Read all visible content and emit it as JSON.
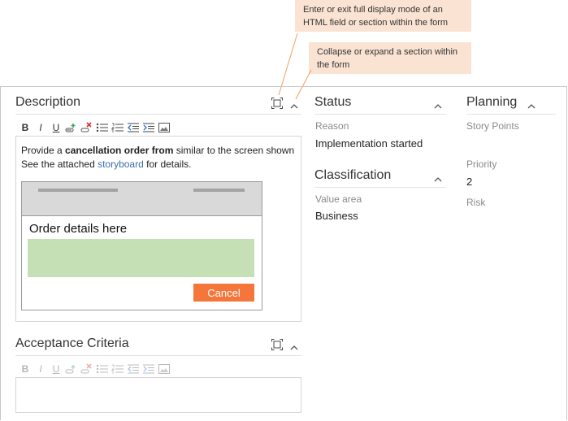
{
  "callouts": {
    "fullscreen": "Enter or exit full display mode of an HTML field or section within the form",
    "collapse": "Collapse or expand a section within the form"
  },
  "description": {
    "title": "Description",
    "text_prefix": "Provide a ",
    "text_bold": "cancellation order from",
    "text_suffix": " similar to the screen shown",
    "line2_prefix": "See the attached ",
    "line2_link": "storyboard",
    "line2_suffix": " for details.",
    "mockup": {
      "title": "Order details here",
      "cancel_label": "Cancel"
    }
  },
  "acceptance": {
    "title": "Acceptance Criteria"
  },
  "status": {
    "title": "Status",
    "reason_label": "Reason",
    "reason_value": "Implementation started"
  },
  "classification": {
    "title": "Classification",
    "value_area_label": "Value area",
    "value_area_value": "Business"
  },
  "planning": {
    "title": "Planning",
    "story_points_label": "Story Points",
    "priority_label": "Priority",
    "priority_value": "2",
    "risk_label": "Risk"
  },
  "toolbar": {
    "bold": "B",
    "italic": "I",
    "underline": "U"
  },
  "colors": {
    "callout_bg": "#fbe3d3",
    "leader_line": "#f0a05a",
    "cancel_button": "#f4763b",
    "mock_green": "#c5e0b4",
    "link": "#3a6fa8"
  }
}
